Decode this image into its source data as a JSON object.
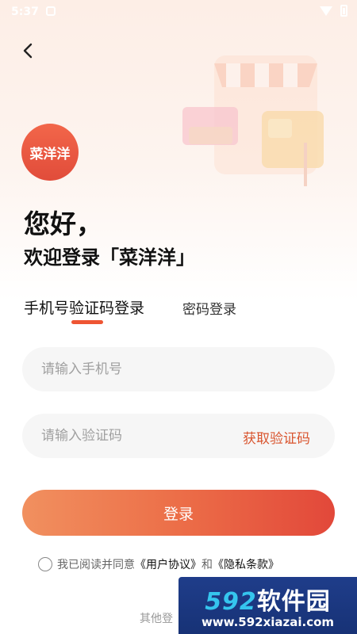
{
  "status_bar": {
    "time": "5:37"
  },
  "brand": {
    "logo_text": "菜洋洋"
  },
  "greeting": {
    "line1": "您好，",
    "line2": "欢迎登录「菜洋洋」"
  },
  "tabs": [
    {
      "label": "手机号验证码登录",
      "active": true
    },
    {
      "label": "密码登录",
      "active": false
    }
  ],
  "form": {
    "phone_placeholder": "请输入手机号",
    "code_placeholder": "请输入验证码",
    "get_code_label": "获取验证码",
    "login_label": "登录"
  },
  "agreement": {
    "prefix": "我已阅读并同意",
    "user_agreement": "《用户协议》",
    "and": "和",
    "privacy": "《隐私条款》"
  },
  "footer": {
    "other_login": "其他登"
  },
  "watermark": {
    "brand_num": "592",
    "brand_text": "软件园",
    "url": "www.592xiazai.com"
  },
  "colors": {
    "accent": "#ee5533",
    "button_start": "#f1905f",
    "button_end": "#e2483a",
    "link": "#d9552f"
  }
}
